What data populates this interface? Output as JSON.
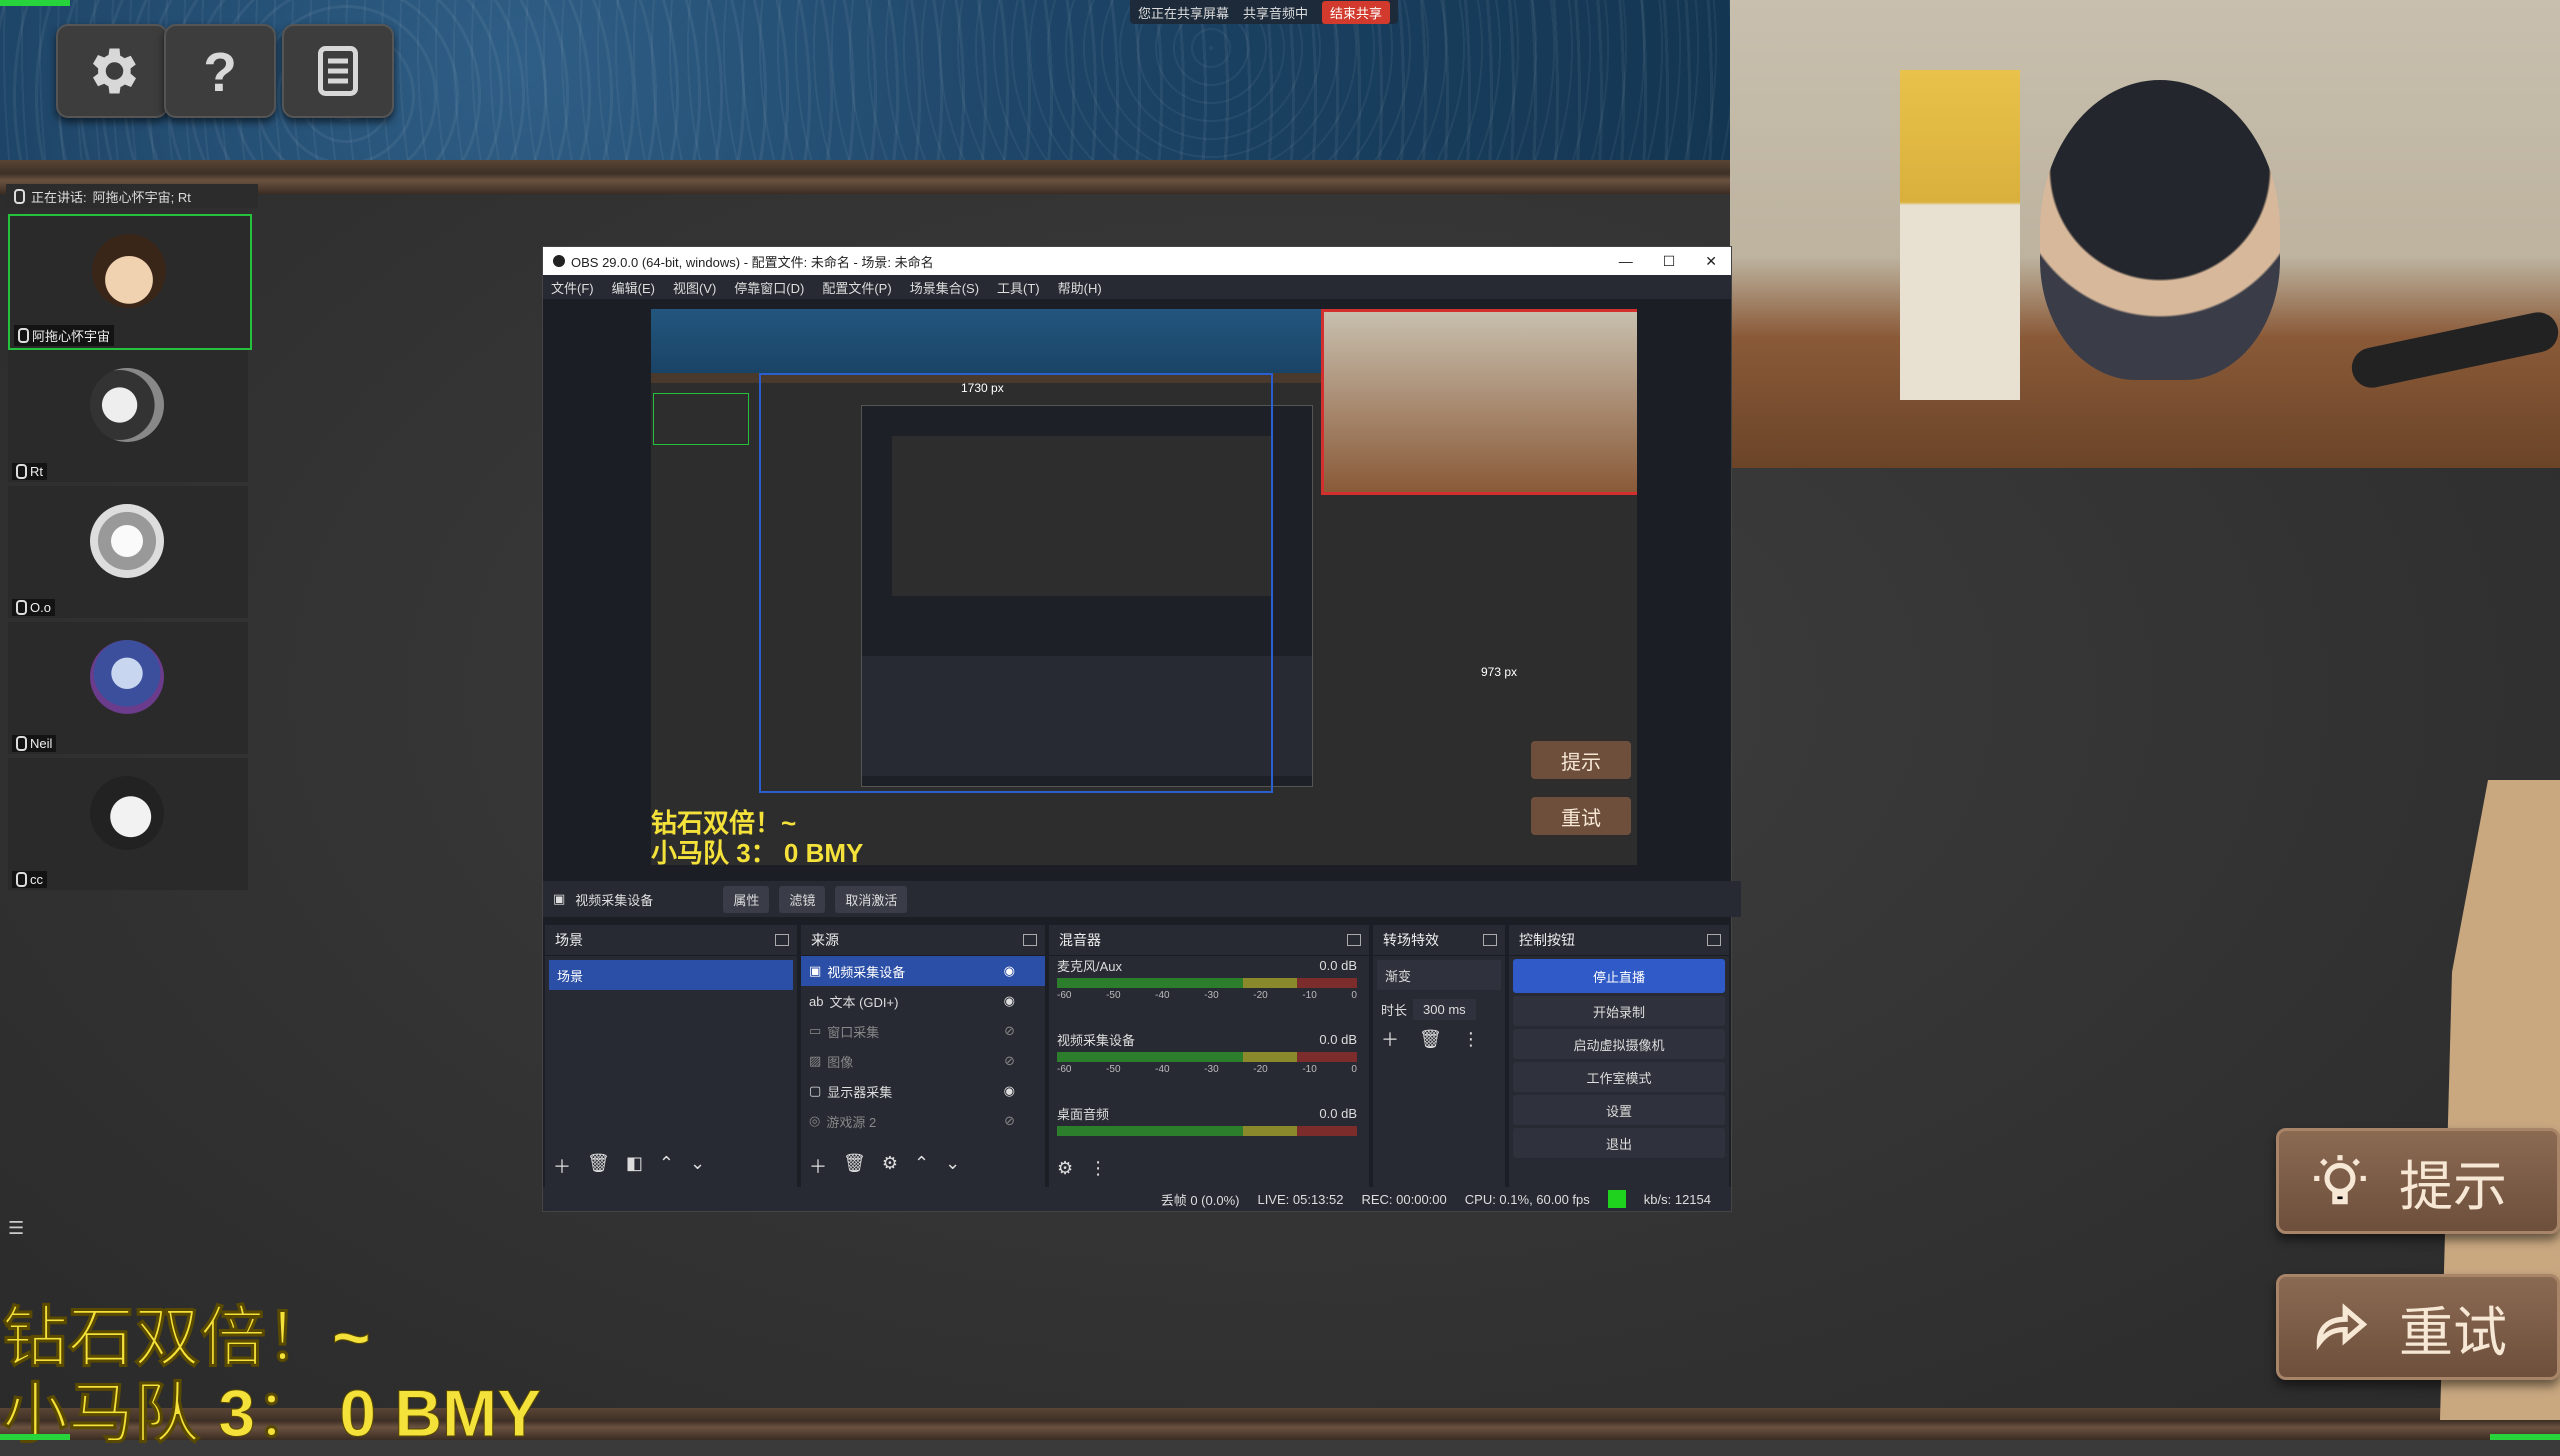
{
  "share_bar": {
    "sharing": "您正在共享屏幕",
    "audio": "共享音频中",
    "end": "结束共享"
  },
  "speaker": {
    "label": "正在讲话:",
    "names": "阿拖心怀宇宙; Rt"
  },
  "participants": [
    {
      "name": "阿拖心怀宇宙",
      "active": true
    },
    {
      "name": "Rt",
      "active": false
    },
    {
      "name": "O.o",
      "active": false
    },
    {
      "name": "Neil",
      "active": false
    },
    {
      "name": "cc",
      "active": false
    }
  ],
  "obs": {
    "title": "OBS 29.0.0 (64-bit, windows) - 配置文件: 未命名 - 场景: 未命名",
    "menu": [
      "文件(F)",
      "编辑(E)",
      "视图(V)",
      "停靠窗口(D)",
      "配置文件(P)",
      "场景集合(S)",
      "工具(T)",
      "帮助(H)"
    ],
    "preview_labels": {
      "width": "1730 px",
      "height": "973 px"
    },
    "source_bar": {
      "name": "视频采集设备",
      "properties": "属性",
      "filters": "滤镜",
      "deactivate": "取消激活"
    },
    "docks": {
      "scenes": {
        "title": "场景",
        "items": [
          "场景"
        ]
      },
      "sources": {
        "title": "来源",
        "items": [
          "视频采集设备",
          "文本 (GDI+)",
          "窗口采集",
          "图像",
          "显示器采集",
          "游戏源 2"
        ]
      },
      "mixer": {
        "title": "混音器",
        "channels": [
          {
            "name": "麦克风/Aux",
            "db": "0.0 dB"
          },
          {
            "name": "视频采集设备",
            "db": "0.0 dB"
          },
          {
            "name": "桌面音频",
            "db": "0.0 dB"
          }
        ],
        "scale": [
          "-60",
          "-55",
          "-50",
          "-45",
          "-40",
          "-35",
          "-30",
          "-25",
          "-20",
          "-15",
          "-10",
          "-5",
          "0"
        ]
      },
      "transitions": {
        "title": "转场特效",
        "type": "渐变",
        "duration_label": "时长",
        "duration": "300 ms"
      },
      "controls": {
        "title": "控制按钮",
        "buttons": [
          "停止直播",
          "开始录制",
          "启动虚拟摄像机",
          "工作室模式",
          "设置",
          "退出"
        ]
      }
    },
    "status": {
      "dropped": "丢帧 0 (0.0%)",
      "live": "LIVE: 05:13:52",
      "rec": "REC: 00:00:00",
      "cpu": "CPU: 0.1%, 60.00 fps",
      "kbs": "kb/s: 12154"
    }
  },
  "overlay": {
    "line1": "钻石双倍！~",
    "line2": "小马队 3： 0 BMY"
  },
  "side_buttons": {
    "hint": "提示",
    "retry": "重试"
  },
  "colors": {
    "accent_green": "#25c13c",
    "obs_blue": "#2f5ac7",
    "overlay_yellow": "#f4e13a"
  }
}
